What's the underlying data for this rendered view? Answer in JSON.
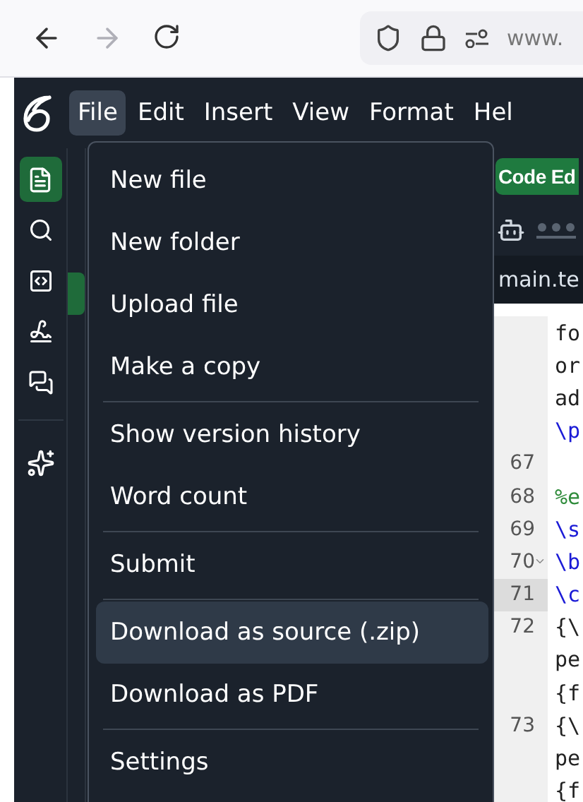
{
  "browser": {
    "url": "www."
  },
  "menubar": [
    {
      "label": "File",
      "selected": true
    },
    {
      "label": "Edit",
      "selected": false
    },
    {
      "label": "Insert",
      "selected": false
    },
    {
      "label": "View",
      "selected": false
    },
    {
      "label": "Format",
      "selected": false
    },
    {
      "label": "Hel",
      "selected": false
    }
  ],
  "rail": [
    {
      "kind": "file",
      "selected": true
    },
    {
      "kind": "search",
      "selected": false
    },
    {
      "kind": "code",
      "selected": false
    },
    {
      "kind": "signature",
      "selected": false
    },
    {
      "kind": "chat",
      "selected": false
    },
    {
      "kind": "sparkle",
      "selected": false
    }
  ],
  "file_menu": [
    [
      {
        "label": "New file",
        "selected": false
      },
      {
        "label": "New folder",
        "selected": false
      },
      {
        "label": "Upload file",
        "selected": false
      },
      {
        "label": "Make a copy",
        "selected": false
      }
    ],
    [
      {
        "label": "Show version history",
        "selected": false
      },
      {
        "label": "Word count",
        "selected": false
      }
    ],
    [
      {
        "label": "Submit",
        "selected": false
      }
    ],
    [
      {
        "label": "Download as source (.zip)",
        "selected": true
      },
      {
        "label": "Download as PDF",
        "selected": false
      }
    ],
    [
      {
        "label": "Settings",
        "selected": false
      }
    ]
  ],
  "editor": {
    "mode_button": "Code Ed",
    "file_tab": "main.te",
    "lines": [
      {
        "text": "fo",
        "kind": "text",
        "fold": false,
        "active": false
      },
      {
        "text": "or",
        "kind": "text",
        "fold": false,
        "active": false
      },
      {
        "text": "ad",
        "kind": "text",
        "fold": false,
        "active": false
      },
      {
        "text": "\\p",
        "kind": "command",
        "fold": false,
        "active": false
      },
      {
        "number": "67",
        "fold": false,
        "active": false
      },
      {
        "number": "68",
        "text": "%e",
        "kind": "comment",
        "fold": false,
        "active": false
      },
      {
        "number": "69",
        "text": "\\s",
        "kind": "command",
        "fold": false,
        "active": false
      },
      {
        "number": "70",
        "text": "\\b",
        "kind": "command",
        "fold": true,
        "active": false
      },
      {
        "number": "71",
        "text": "\\c",
        "kind": "command",
        "fold": false,
        "active": true
      },
      {
        "number": "72",
        "text": "{\\",
        "kind": "text",
        "fold": false,
        "active": false
      },
      {
        "text": "pe",
        "kind": "text",
        "fold": false,
        "active": false
      },
      {
        "text": "{f",
        "kind": "text",
        "fold": false,
        "active": false
      },
      {
        "number": "73",
        "text": "{\\",
        "kind": "text",
        "fold": false,
        "active": false
      },
      {
        "text": "pe",
        "kind": "text",
        "fold": false,
        "active": false
      },
      {
        "text": "{f",
        "kind": "text",
        "fold": false,
        "active": false
      }
    ]
  }
}
